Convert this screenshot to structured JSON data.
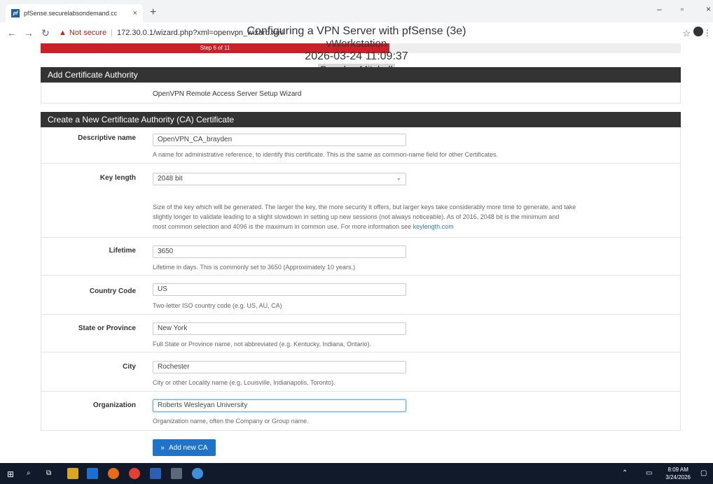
{
  "browser": {
    "tab_title": "pfSense.securelabsondemand.cc",
    "tab_favicon": "pf",
    "tab_close": "×",
    "new_tab": "+",
    "minimize": "–",
    "restore": "▫",
    "close": "×",
    "not_secure": "Not secure",
    "separator": "|",
    "url": "172.30.0.1/wizard.php?xml=openvpn_wizard.xml",
    "warning_icon": "warning-triangle-icon"
  },
  "overlay": {
    "title": "Configuring a VPN Server with pfSense (3e)",
    "machine": "vWorkstation",
    "datetime": "2026-03-24 11:09:37",
    "user": "Brayden Mitchell"
  },
  "progress": {
    "label": "Step 6 of 11",
    "fraction": 0.545
  },
  "sections": {
    "ca_header": "Add Certificate Authority",
    "wizard_title": "OpenVPN Remote Access Server Setup Wizard",
    "create_header": "Create a New Certificate Authority (CA) Certificate"
  },
  "fields": {
    "descriptive_name": {
      "label": "Descriptive name",
      "value": "OpenVPN_CA_brayden",
      "help": "A name for administrative reference, to identify this certificate. This is the same as common-name field for other Certificates."
    },
    "key_length": {
      "label": "Key length",
      "value": "2048 bit",
      "help_line1": "Size of the key which will be generated. The larger the key, the more security it offers, but larger keys take considerably more time to generate, and take",
      "help_line2": "slightly longer to validate leading to a slight slowdown in setting up new sessions (not always noticeable). As of 2016, 2048 bit is the minimum and",
      "help_line3": "most common selection and 4096 is the maximum in common use. For more information see ",
      "help_link": "keylength.com"
    },
    "lifetime": {
      "label": "Lifetime",
      "value": "3650",
      "help": "Lifetime in days. This is commonly set to 3650 (Approximately 10 years.)"
    },
    "country_code": {
      "label": "Country Code",
      "value": "US",
      "help": "Two-letter ISO country code (e.g. US, AU, CA)"
    },
    "state": {
      "label": "State or Province",
      "value": "New York",
      "help": "Full State or Province name, not abbreviated (e.g. Kentucky, Indiana, Ontario)."
    },
    "city": {
      "label": "City",
      "value": "Rochester",
      "help": "City or other Locality name (e.g. Louisville, Indianapolis, Toronto)."
    },
    "organization": {
      "label": "Organization",
      "value": "Roberts Wesleyan University",
      "help": "Organization name, often the Company or Group name."
    }
  },
  "add_button": {
    "icon": "»",
    "label": "Add new CA"
  },
  "taskbar": {
    "time": "8:09 AM",
    "date": "3/24/2026"
  }
}
